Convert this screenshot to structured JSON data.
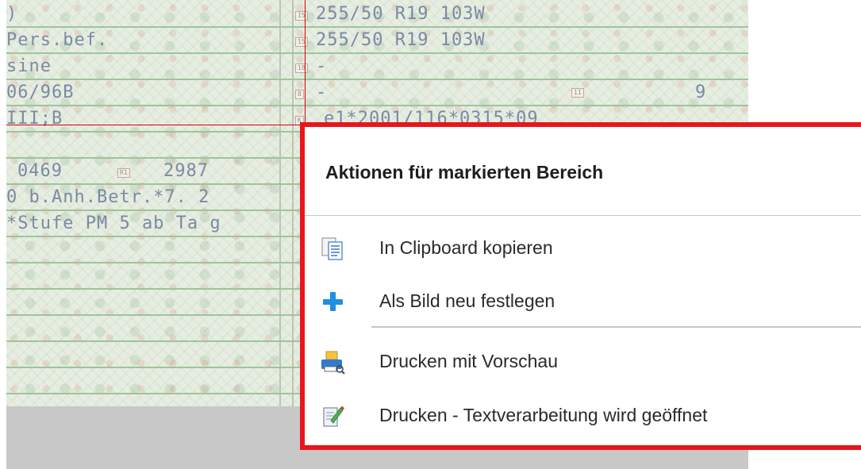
{
  "document": {
    "rows": [
      {
        "left": ")",
        "right": "255/50 R19 103W",
        "right_tag": "15"
      },
      {
        "left": "Pers.bef.",
        "right": "255/50 R19 103W",
        "right_tag": "15"
      },
      {
        "left": "sine",
        "right": "-",
        "right_tag": "18"
      },
      {
        "left": "06/96B",
        "right": "-",
        "right_tag": "8",
        "mid_tag": "11",
        "mid_value": "9"
      },
      {
        "left": "III;B",
        "right": "e1*2001/116*0315*09",
        "right_tag": "K"
      },
      {
        "left": "",
        "right": ""
      },
      {
        "left": "0469",
        "left_tag": "R1",
        "left_extra": "2987",
        "right": ""
      },
      {
        "left": "0 b.Anh.Betr.*7. 2",
        "right": ""
      },
      {
        "left": "*Stufe PM 5 ab Ta g",
        "right": ""
      }
    ]
  },
  "context_menu": {
    "title": "Aktionen für markierten Bereich",
    "items": [
      {
        "label": "In Clipboard kopieren",
        "icon": "clipboard-copy-icon"
      },
      {
        "label": "Als Bild neu festlegen",
        "icon": "plus-icon"
      },
      {
        "label": "Drucken mit Vorschau",
        "icon": "printer-preview-icon"
      },
      {
        "label": "Drucken - Textverarbeitung wird geöffnet",
        "icon": "document-edit-icon"
      }
    ],
    "border_color": "#e8161c"
  }
}
